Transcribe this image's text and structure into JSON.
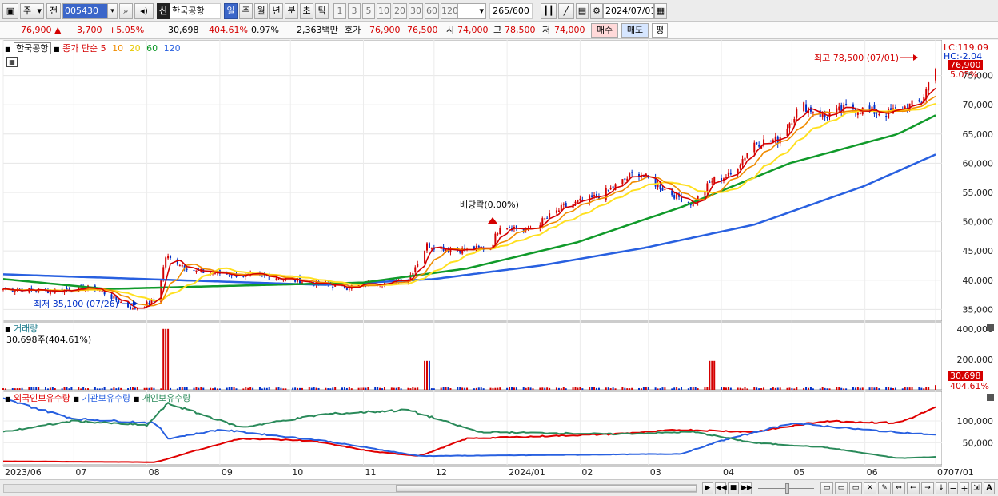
{
  "toolbar": {
    "period_week": "주",
    "period_prev": "전",
    "stock_code": "005430",
    "credit_badge": "신",
    "stock_name": "한국공항",
    "intervals": [
      "일",
      "주",
      "월",
      "년",
      "분",
      "초",
      "틱"
    ],
    "active_interval": "일",
    "tick_counts": [
      "1",
      "3",
      "5",
      "10",
      "20",
      "30",
      "60",
      "120"
    ],
    "bar_count": "265",
    "bar_total": "/600",
    "date": "2024/07/01"
  },
  "quote": {
    "price": "76,900",
    "change": "3,700",
    "change_pct": "+5.05%",
    "volume": "30,698",
    "volume_ratio": "404.61%",
    "turnover_pct": "0.97%",
    "amount": "2,363백만",
    "bid_label": "호가",
    "bid1": "76,900",
    "bid2": "76,500",
    "open_label": "시",
    "open": "74,000",
    "high_label": "고",
    "high": "78,500",
    "low_label": "저",
    "low": "74,000",
    "buy_label": "매수",
    "sell_label": "매도",
    "eval_label": "평"
  },
  "colors": {
    "up": "#d40000",
    "down": "#0030c8",
    "ma5": "#d40000",
    "ma10": "#f08c00",
    "ma20": "#ffe020",
    "ma60": "#109a2a",
    "ma120": "#2860e0",
    "foreign": "#e00000",
    "institution": "#2860e0",
    "individual": "#2a8a5a"
  },
  "chart_data": [
    {
      "type": "candlestick",
      "title": "한국공항",
      "legend": {
        "label": "종가 단순",
        "periods": [
          "5",
          "10",
          "20",
          "60",
          "120"
        ]
      },
      "ylim": [
        33000,
        80000
      ],
      "y_ticks": [
        "35,000",
        "40,000",
        "45,000",
        "50,000",
        "55,000",
        "60,000",
        "65,000",
        "70,000",
        "75,000"
      ],
      "x_ticks": [
        "2023/06",
        "07",
        "08",
        "09",
        "10",
        "11",
        "12",
        "2024/01",
        "02",
        "03",
        "04",
        "05",
        "06",
        "07",
        "07/01"
      ],
      "right_top": "LC:119.09",
      "right_second": "HC:-2.04",
      "last_price_tag": "76,900",
      "last_pct_tag": "5.05%",
      "annotations": {
        "high": "최고 78,500 (07/01)",
        "low": "최저 35,100 (07/26)",
        "dividend": "배당락(0.00%)"
      },
      "close_path": [
        [
          "2023-06-01",
          38500
        ],
        [
          "2023-06-20",
          38200
        ],
        [
          "2023-07-10",
          38700
        ],
        [
          "2023-07-26",
          35100
        ],
        [
          "2023-08-05",
          36500
        ],
        [
          "2023-08-09",
          44000
        ],
        [
          "2023-08-22",
          41500
        ],
        [
          "2023-09-05",
          41000
        ],
        [
          "2023-09-25",
          40500
        ],
        [
          "2023-10-10",
          39500
        ],
        [
          "2023-10-25",
          38800
        ],
        [
          "2023-11-05",
          39500
        ],
        [
          "2023-11-20",
          40200
        ],
        [
          "2023-11-28",
          46000
        ],
        [
          "2023-12-10",
          45200
        ],
        [
          "2023-12-25",
          45500
        ],
        [
          "2023-12-29",
          49500
        ],
        [
          "2024-01-10",
          48500
        ],
        [
          "2024-01-25",
          52500
        ],
        [
          "2024-02-10",
          54500
        ],
        [
          "2024-02-25",
          58500
        ],
        [
          "2024-03-10",
          55000
        ],
        [
          "2024-03-20",
          53000
        ],
        [
          "2024-03-28",
          57000
        ],
        [
          "2024-04-05",
          58000
        ],
        [
          "2024-04-15",
          63500
        ],
        [
          "2024-04-25",
          64000
        ],
        [
          "2024-05-05",
          70000
        ],
        [
          "2024-05-15",
          68000
        ],
        [
          "2024-05-25",
          69500
        ],
        [
          "2024-06-10",
          68500
        ],
        [
          "2024-06-25",
          70500
        ],
        [
          "2024-07-01",
          76900
        ]
      ],
      "ma_paths": {
        "ma60": [
          [
            "2023-06-01",
            40200
          ],
          [
            "2023-07-15",
            38500
          ],
          [
            "2023-09-01",
            39000
          ],
          [
            "2023-11-01",
            39600
          ],
          [
            "2023-12-15",
            42000
          ],
          [
            "2024-01-31",
            46500
          ],
          [
            "2024-03-15",
            52500
          ],
          [
            "2024-04-30",
            60000
          ],
          [
            "2024-06-15",
            65000
          ],
          [
            "2024-07-01",
            68200
          ]
        ],
        "ma120": [
          [
            "2023-06-01",
            41000
          ],
          [
            "2023-08-15",
            40000
          ],
          [
            "2023-10-15",
            39200
          ],
          [
            "2023-12-01",
            40200
          ],
          [
            "2024-01-15",
            42500
          ],
          [
            "2024-02-28",
            45500
          ],
          [
            "2024-04-15",
            49500
          ],
          [
            "2024-05-31",
            56000
          ],
          [
            "2024-07-01",
            61500
          ]
        ]
      }
    },
    {
      "type": "bar",
      "title": "거래량",
      "current": "30,698주(404.61%)",
      "y_ticks": [
        "200,000",
        "400,000"
      ],
      "ylim": [
        0,
        420000
      ],
      "right_value": "30,698",
      "right_pct": "404.61%",
      "spikes": [
        [
          "2023-08-09",
          400000
        ],
        [
          "2023-11-28",
          190000
        ],
        [
          "2024-03-28",
          190000
        ],
        [
          "2024-07-01",
          30698
        ]
      ]
    },
    {
      "type": "line",
      "legend": [
        "외국인보유수량",
        "기관보유수량",
        "개인보유수량"
      ],
      "y_ticks": [
        "50,000",
        "100,000"
      ],
      "ylim": [
        0,
        160000
      ],
      "series": [
        {
          "name": "외국인보유수량",
          "values": [
            [
              "2023-06-01",
              8000
            ],
            [
              "2023-08-05",
              6000
            ],
            [
              "2023-08-20",
              30000
            ],
            [
              "2023-09-10",
              60000
            ],
            [
              "2023-10-10",
              55000
            ],
            [
              "2023-11-05",
              30000
            ],
            [
              "2023-11-25",
              20000
            ],
            [
              "2023-12-15",
              60000
            ],
            [
              "2024-01-15",
              65000
            ],
            [
              "2024-02-15",
              70000
            ],
            [
              "2024-03-15",
              80000
            ],
            [
              "2024-04-15",
              75000
            ],
            [
              "2024-05-15",
              100000
            ],
            [
              "2024-06-15",
              95000
            ],
            [
              "2024-07-01",
              130000
            ]
          ]
        },
        {
          "name": "기관보유수량",
          "values": [
            [
              "2023-06-01",
              150000
            ],
            [
              "2023-07-01",
              105000
            ],
            [
              "2023-08-05",
              95000
            ],
            [
              "2023-08-10",
              60000
            ],
            [
              "2023-09-01",
              80000
            ],
            [
              "2023-10-15",
              55000
            ],
            [
              "2023-11-25",
              20000
            ],
            [
              "2024-01-15",
              22000
            ],
            [
              "2024-03-15",
              25000
            ],
            [
              "2024-04-01",
              55000
            ],
            [
              "2024-05-01",
              95000
            ],
            [
              "2024-06-01",
              80000
            ],
            [
              "2024-07-01",
              68000
            ]
          ]
        },
        {
          "name": "개인보유수량",
          "values": [
            [
              "2023-06-01",
              75000
            ],
            [
              "2023-07-01",
              100000
            ],
            [
              "2023-08-01",
              90000
            ],
            [
              "2023-08-10",
              140000
            ],
            [
              "2023-09-10",
              85000
            ],
            [
              "2023-10-15",
              115000
            ],
            [
              "2023-11-20",
              125000
            ],
            [
              "2023-12-20",
              75000
            ],
            [
              "2024-02-15",
              70000
            ],
            [
              "2024-03-20",
              75000
            ],
            [
              "2024-04-15",
              50000
            ],
            [
              "2024-05-15",
              40000
            ],
            [
              "2024-06-15",
              15000
            ],
            [
              "2024-07-01",
              18000
            ]
          ]
        }
      ]
    }
  ],
  "scroll": {
    "speed_icons": [
      "play-right",
      "fast-back",
      "stop",
      "fast-forward"
    ]
  }
}
